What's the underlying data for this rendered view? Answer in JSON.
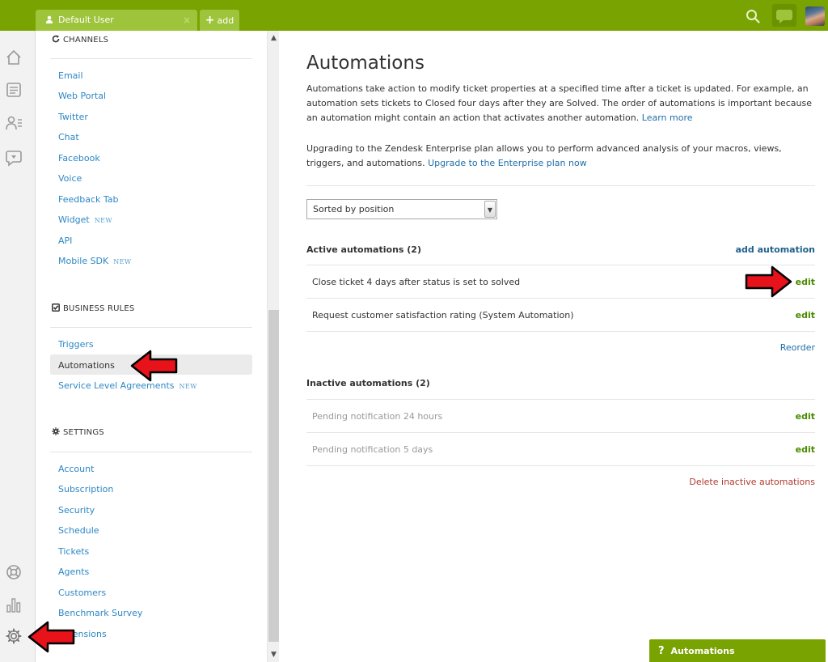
{
  "topbar": {
    "user_tab": "Default User",
    "close_glyph": "×",
    "add_tab": "add",
    "add_glyph": "+",
    "icons": [
      "user-icon",
      "search-icon",
      "chat-icon",
      "avatar"
    ]
  },
  "rail": {
    "icons": [
      "home-icon",
      "views-icon",
      "customers-icon",
      "reporting-chat-icon",
      "help-ring-icon",
      "bar-chart-icon",
      "gear-icon"
    ]
  },
  "sidebar": {
    "channels": {
      "title": "CHANNELS",
      "items": [
        {
          "label": "Email",
          "new": ""
        },
        {
          "label": "Web Portal",
          "new": ""
        },
        {
          "label": "Twitter",
          "new": ""
        },
        {
          "label": "Chat",
          "new": ""
        },
        {
          "label": "Facebook",
          "new": ""
        },
        {
          "label": "Voice",
          "new": ""
        },
        {
          "label": "Feedback Tab",
          "new": ""
        },
        {
          "label": "Widget",
          "new": "NEW"
        },
        {
          "label": "API",
          "new": ""
        },
        {
          "label": "Mobile SDK",
          "new": "NEW"
        }
      ]
    },
    "business_rules": {
      "title": "BUSINESS RULES",
      "items": [
        {
          "label": "Triggers",
          "new": ""
        },
        {
          "label": "Automations",
          "new": ""
        },
        {
          "label": "Service Level Agreements",
          "new": "NEW"
        }
      ],
      "selected": "Automations"
    },
    "settings": {
      "title": "SETTINGS",
      "items": [
        {
          "label": "Account"
        },
        {
          "label": "Subscription"
        },
        {
          "label": "Security"
        },
        {
          "label": "Schedule"
        },
        {
          "label": "Tickets"
        },
        {
          "label": "Agents"
        },
        {
          "label": "Customers"
        },
        {
          "label": "Benchmark Survey"
        },
        {
          "label": "Extensions"
        }
      ]
    }
  },
  "main": {
    "title": "Automations",
    "intro": "Automations take action to modify ticket properties at a specified time after a ticket is updated. For example, an automation sets tickets to Closed four days after they are Solved. The order of automations is important because an automation might contain an action that activates another automation.",
    "learn_more": "Learn more",
    "upgrade_text": "Upgrading to the Zendesk Enterprise plan allows you to perform advanced analysis of your macros, views, triggers, and automations.",
    "upgrade_link": "Upgrade to the Enterprise plan now",
    "sort_select": "Sorted by position",
    "active_header": "Active automations (2)",
    "add_automation": "add automation",
    "active_rows": [
      {
        "label": "Close ticket 4 days after status is set to solved",
        "action": "edit"
      },
      {
        "label": "Request customer satisfaction rating (System Automation)",
        "action": "edit"
      }
    ],
    "reorder": "Reorder",
    "inactive_header": "Inactive automations (2)",
    "inactive_rows": [
      {
        "label": "Pending notification 24 hours",
        "action": "edit"
      },
      {
        "label": "Pending notification 5 days",
        "action": "edit"
      }
    ],
    "delete_inactive": "Delete inactive automations"
  },
  "help_widget": {
    "glyph": "?",
    "label": "Automations"
  },
  "colors": {
    "brand_green": "#78a300",
    "link_blue": "#2c87c5",
    "edit_green": "#4a8a00",
    "delete_red": "#b03a2e",
    "annotation_red": "#e8121a"
  }
}
